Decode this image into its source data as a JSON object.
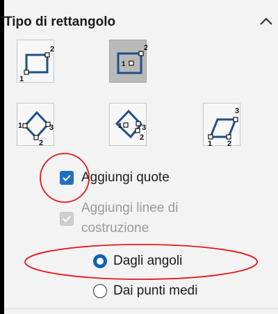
{
  "section": {
    "title": "Tipo di rettangolo",
    "collapse_icon": "chevron-up-icon"
  },
  "rect_types": [
    {
      "id": "corner",
      "labels": [
        "1",
        "2"
      ],
      "selected": false
    },
    {
      "id": "center",
      "labels": [
        "1",
        "2"
      ],
      "selected": true
    },
    {
      "id": "three-point-corner",
      "labels": [
        "1",
        "2",
        "3"
      ],
      "selected": false
    },
    {
      "id": "three-point-center",
      "labels": [
        "1",
        "2",
        "3"
      ],
      "selected": false
    },
    {
      "id": "parallelogram",
      "labels": [
        "1",
        "2",
        "3"
      ],
      "selected": false
    }
  ],
  "options": {
    "add_dimensions": {
      "label": "Aggiungi quote",
      "checked": true
    },
    "add_construction_lines": {
      "label_line1": "Aggiungi linee di",
      "label_line2": "costruzione",
      "checked": true,
      "enabled": false
    }
  },
  "radios": {
    "from_corners": {
      "label": "Dagli angoli",
      "selected": true
    },
    "from_midpoints": {
      "label": "Dai punti medi",
      "selected": false
    }
  },
  "colors": {
    "accent": "#1f6fc5",
    "annotation": "#e8151b"
  }
}
